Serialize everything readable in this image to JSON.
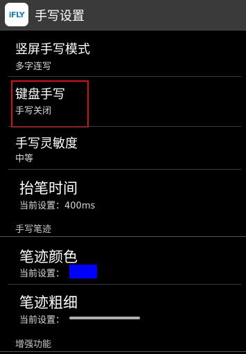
{
  "header": {
    "app_icon_text": "iFLY",
    "title": "手写设置"
  },
  "settings": [
    {
      "title": "竖屏手写模式",
      "summary": "多字连写"
    },
    {
      "title": "键盘手写",
      "summary": "手写关闭"
    },
    {
      "title": "手写灵敏度",
      "summary": "中等"
    },
    {
      "title": "抬笔时间",
      "summary": "当前设置：400ms"
    }
  ],
  "sections": {
    "pen_trail": "手写笔迹",
    "enhanced": "增强功能"
  },
  "pen_trail_items": [
    {
      "title": "笔迹颜色",
      "summary": "当前设置：",
      "color": "#0000ff"
    },
    {
      "title": "笔迹粗细",
      "summary": "当前设置："
    }
  ],
  "colors": {
    "highlight_border": "#d0121b",
    "pen_color": "#0000ff"
  }
}
